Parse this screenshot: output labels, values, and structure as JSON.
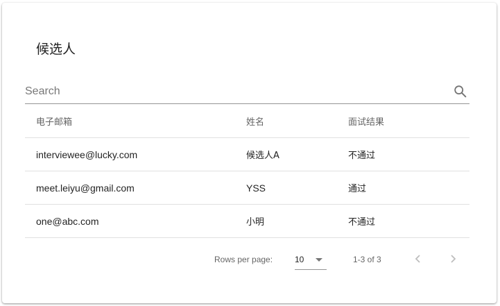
{
  "page": {
    "title": "候选人"
  },
  "search": {
    "placeholder": "Search",
    "value": ""
  },
  "table": {
    "headers": [
      "电子邮箱",
      "姓名",
      "面试结果"
    ],
    "rows": [
      [
        "interviewee@lucky.com",
        "候选人A",
        "不通过"
      ],
      [
        "meet.leiyu@gmail.com",
        "YSS",
        "通过"
      ],
      [
        "one@abc.com",
        "小明",
        "不通过"
      ]
    ]
  },
  "pagination": {
    "rows_per_page_label": "Rows per page:",
    "rows_per_page_value": "10",
    "range": "1-3 of 3"
  },
  "icons": {
    "search": "search-icon",
    "rows_dropdown": "caret-down-icon",
    "previous": "chevron-left-icon",
    "next": "chevron-right-icon"
  },
  "colors": {
    "icon_active": "#757575",
    "icon_disabled": "#bdbdbd",
    "divider": "#e0e0e0"
  }
}
